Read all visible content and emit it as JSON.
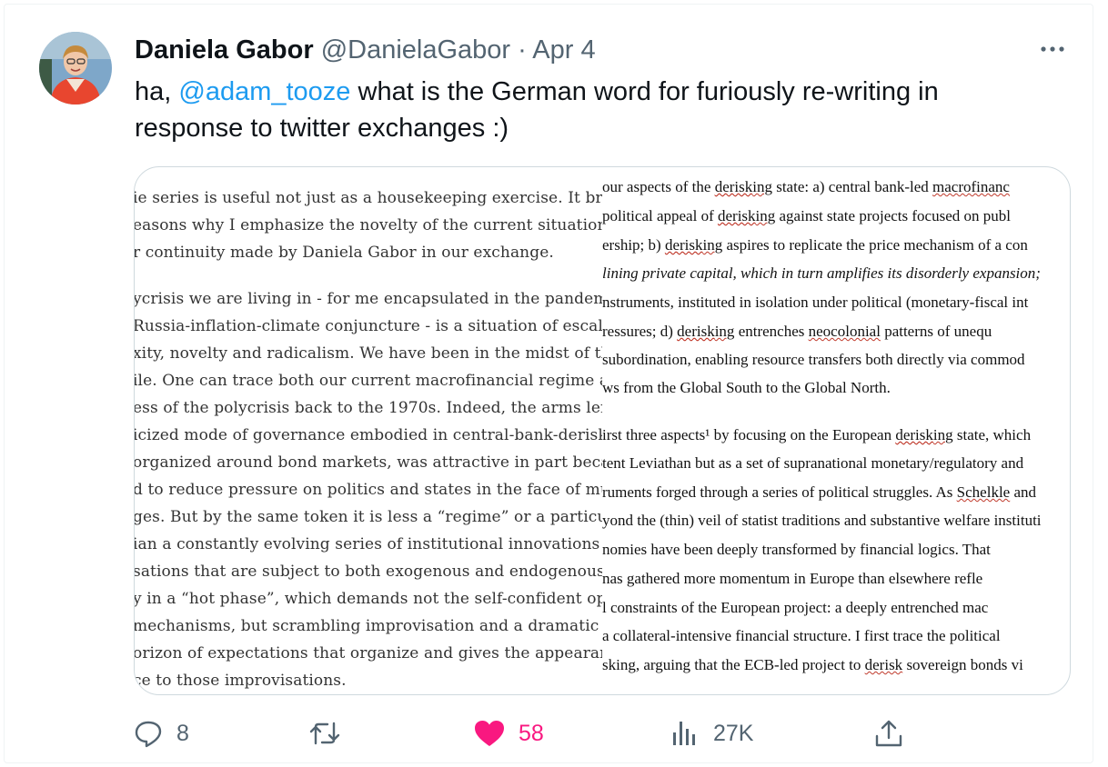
{
  "tweet": {
    "author_name": "Daniela Gabor",
    "author_handle": "@DanielaGabor",
    "separator": "·",
    "date": "Apr 4",
    "text_prefix": "ha, ",
    "mention": "@adam_tooze",
    "text_rest": " what is the German word for furiously re-writing in response to twitter exchanges :)"
  },
  "media_left": {
    "lines": [
      "ie series is useful not just as a housekeeping exercise. It bring",
      "easons why I emphasize the novelty of the current situation o",
      "r continuity made by Daniela Gabor in our exchange.",
      "ycrisis we are living in - for me encapsulated in the pandemic",
      "Russia-inflation-climate conjuncture - is a situation of escalat",
      "xity, novelty and radicalism. We have been in the midst of the",
      "ile. One can trace both our current macrofinancial regime an",
      "ess of the polycrisis back to the 1970s. Indeed, the arms length",
      "icized mode of governance embodied in central-bank-deriske",
      "organized around bond markets, was attractive in part becau",
      "d to reduce pressure on politics and states in the face of mult",
      "ges. But by the same token it is less a “regime” or a particular",
      "ian a constantly evolving series of institutional innovations a",
      "sations that are subject to both exogenous and endogenous sl",
      "y in a “hot phase”, which demands not the self-confident ope",
      " mechanisms, but scrambling improvisation and a dramatic r",
      "orizon of expectations that organize and gives the appearance",
      "ce to those improvisations."
    ]
  },
  "media_right": {
    "lines": [
      "our aspects of the derisking state: a) central bank-led macrofinanc",
      " political appeal of derisking against state projects focused on publ",
      "ership; b) derisking aspires to replicate the price mechanism of a con",
      "lining private capital, which in turn amplifies its disorderly expansion;",
      "nstruments, instituted in isolation under political (monetary-fiscal int",
      "ressures; d) derisking entrenches neocolonial patterns of unequ",
      " subordination, enabling resource transfers both directly via commod",
      "ws from the Global South to the Global North.",
      "irst three aspects¹ by focusing on the European derisking state, which",
      "tent Leviathan but as a set of supranational monetary/regulatory and",
      "ruments forged through a series of political struggles. As Schelkle and",
      "yond the (thin) veil of statist traditions and substantive welfare instituti",
      "nomies have been deeply transformed by financial logics. That",
      "nas gathered more momentum in Europe than elsewhere refle",
      "l constraints of the European project: a deeply entrenched mac",
      " a collateral-intensive financial structure. I first trace the political",
      "sking, arguing that the ECB-led project to derisk sovereign bonds vi"
    ]
  },
  "actions": {
    "reply_count": "8",
    "retweet_count": "",
    "like_count": "58",
    "views_count": "27K"
  },
  "colors": {
    "accent": "#1d9bf0",
    "like": "#f91880",
    "muted": "#536471"
  },
  "icons": [
    "more-icon",
    "reply-icon",
    "retweet-icon",
    "like-icon",
    "views-icon",
    "share-icon"
  ]
}
